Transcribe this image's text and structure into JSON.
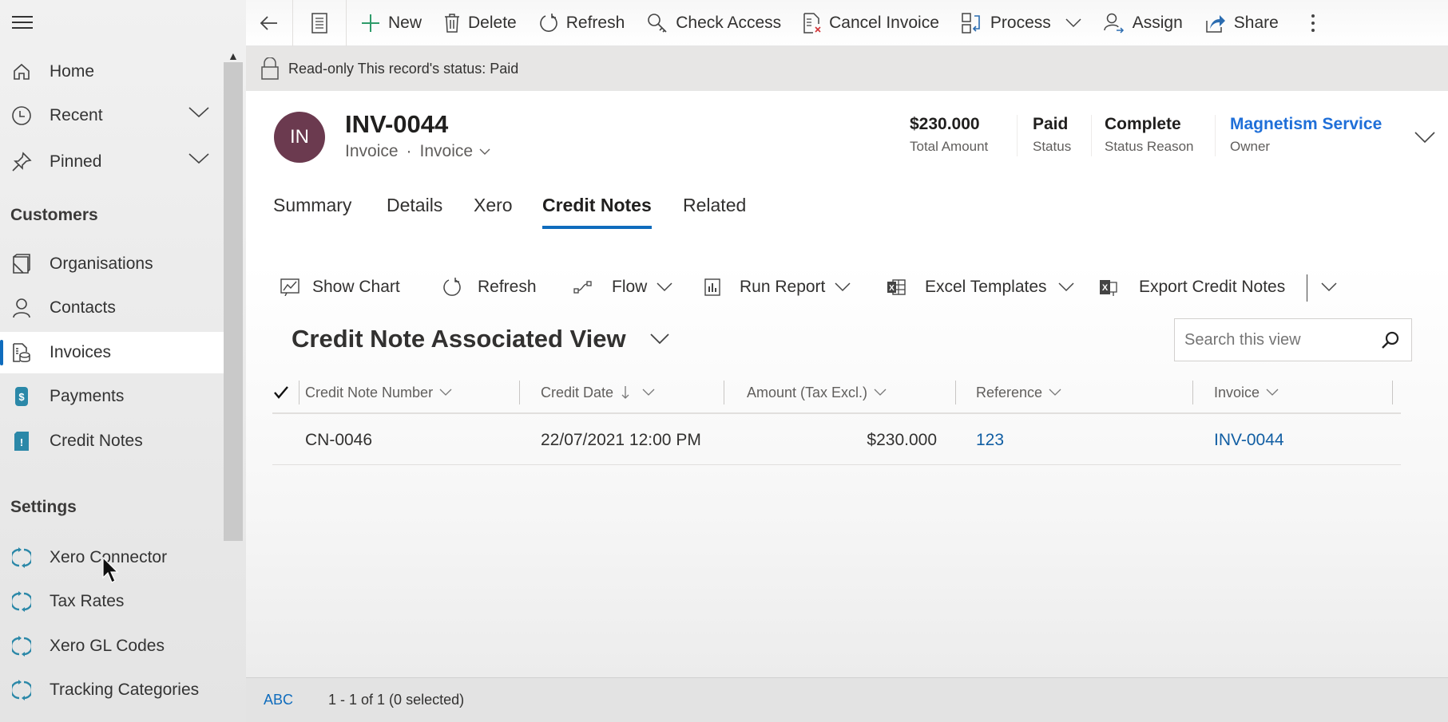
{
  "sidebar": {
    "top_items": [
      {
        "label": "Home",
        "icon": "home-icon"
      },
      {
        "label": "Recent",
        "icon": "clock-icon",
        "expandable": true
      },
      {
        "label": "Pinned",
        "icon": "pin-icon",
        "expandable": true
      }
    ],
    "sections": [
      {
        "title": "Customers",
        "items": [
          {
            "label": "Organisations",
            "icon": "organisation-icon"
          },
          {
            "label": "Contacts",
            "icon": "person-icon"
          },
          {
            "label": "Invoices",
            "icon": "invoice-icon",
            "active": true
          },
          {
            "label": "Payments",
            "icon": "payment-icon"
          },
          {
            "label": "Credit Notes",
            "icon": "credit-note-icon"
          }
        ]
      },
      {
        "title": "Settings",
        "items": [
          {
            "label": "Xero Connector",
            "icon": "sync-icon"
          },
          {
            "label": "Tax Rates",
            "icon": "sync-icon"
          },
          {
            "label": "Xero GL Codes",
            "icon": "sync-icon"
          },
          {
            "label": "Tracking Categories",
            "icon": "sync-icon"
          }
        ]
      }
    ]
  },
  "commandbar": {
    "items": [
      {
        "label": "New",
        "icon": "plus-icon"
      },
      {
        "label": "Delete",
        "icon": "trash-icon"
      },
      {
        "label": "Refresh",
        "icon": "refresh-icon"
      },
      {
        "label": "Check Access",
        "icon": "key-icon"
      },
      {
        "label": "Cancel Invoice",
        "icon": "cancel-document-icon"
      },
      {
        "label": "Process",
        "icon": "process-icon",
        "dropdown": true
      },
      {
        "label": "Assign",
        "icon": "assign-icon"
      },
      {
        "label": "Share",
        "icon": "share-icon"
      }
    ]
  },
  "banner": {
    "text": "Read-only  This record's status: Paid"
  },
  "record": {
    "avatar_initials": "IN",
    "avatar_color": "#6b3a4f",
    "title": "INV-0044",
    "entity": "Invoice",
    "form": "Invoice",
    "header_fields": [
      {
        "value": "$230.000",
        "label": "Total Amount"
      },
      {
        "value": "Paid",
        "label": "Status"
      },
      {
        "value": "Complete",
        "label": "Status Reason"
      },
      {
        "value": "Magnetism Service",
        "label": "Owner",
        "link": true
      }
    ],
    "tabs": [
      {
        "label": "Summary"
      },
      {
        "label": "Details"
      },
      {
        "label": "Xero"
      },
      {
        "label": "Credit Notes",
        "active": true
      },
      {
        "label": "Related"
      }
    ]
  },
  "subgrid": {
    "commands": [
      {
        "label": "Show Chart",
        "icon": "chart-icon"
      },
      {
        "label": "Refresh",
        "icon": "refresh-icon"
      },
      {
        "label": "Flow",
        "icon": "flow-icon",
        "dropdown": true
      },
      {
        "label": "Run Report",
        "icon": "report-icon",
        "dropdown": true
      },
      {
        "label": "Excel Templates",
        "icon": "excel-icon",
        "dropdown": true
      },
      {
        "label": "Export Credit Notes",
        "icon": "excel-export-icon",
        "split_dropdown": true
      }
    ],
    "view_name": "Credit Note Associated View",
    "search_placeholder": "Search this view",
    "columns": [
      {
        "label": "Credit Note Number"
      },
      {
        "label": "Credit Date",
        "sort": "descending"
      },
      {
        "label": "Amount (Tax Excl.)"
      },
      {
        "label": "Reference"
      },
      {
        "label": "Invoice"
      }
    ],
    "rows": [
      {
        "credit_note_number": "CN-0046",
        "credit_date": "22/07/2021 12:00 PM",
        "amount": "$230.000",
        "reference": "123",
        "invoice": "INV-0044"
      }
    ]
  },
  "footer": {
    "abc": "ABC",
    "count": "1 - 1 of 1 (0 selected)"
  },
  "colors": {
    "accent": "#0f6cbd",
    "link": "#115ea3",
    "owner_link": "#1f6fd8",
    "sync_icon": "#2b88a8"
  }
}
